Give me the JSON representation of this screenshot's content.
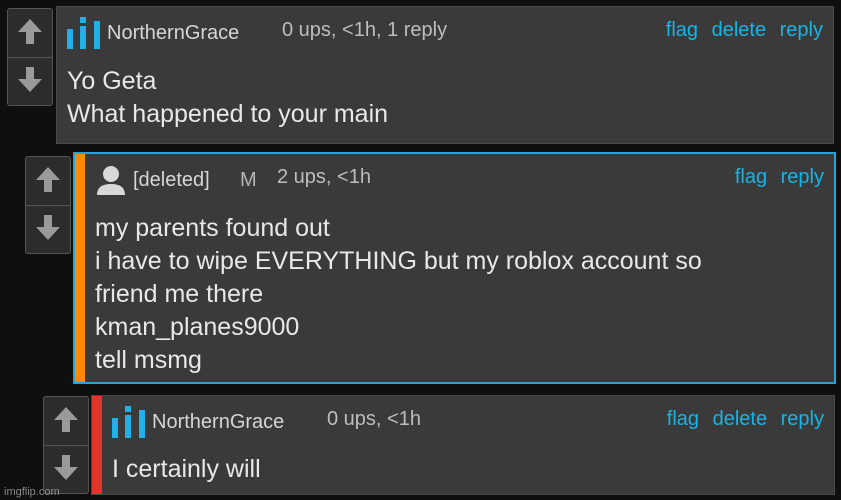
{
  "colors": {
    "accent": "#18b4e6",
    "selected_border": "#22a6d9",
    "orange_bar": "#ff8a00",
    "red_bar": "#e0352b",
    "background": "#0f0f0f",
    "comment_bg": "#3a3a3a"
  },
  "icons": {
    "upvote": "up-arrow-icon",
    "downvote": "down-arrow-icon",
    "user_logo": "northerngrace-bars-logo",
    "avatar": "default-avatar-icon"
  },
  "comments": [
    {
      "username": "NorthernGrace",
      "meta": "0 ups, <1h, 1 reply",
      "actions": [
        "flag",
        "delete",
        "reply"
      ],
      "lines": [
        "Yo Geta",
        "What happened to your main"
      ]
    },
    {
      "username": "[deleted]",
      "badge": "M",
      "meta": "2 ups, <1h",
      "actions": [
        "flag",
        "reply"
      ],
      "lines": [
        "my parents found out",
        "i have to wipe EVERYTHING but my roblox account so",
        "friend me there",
        "kman_planes9000",
        "tell msmg"
      ]
    },
    {
      "username": "NorthernGrace",
      "meta": "0 ups, <1h",
      "actions": [
        "flag",
        "delete",
        "reply"
      ],
      "lines": [
        "I certainly will"
      ]
    }
  ],
  "watermark": "imgflip.com"
}
